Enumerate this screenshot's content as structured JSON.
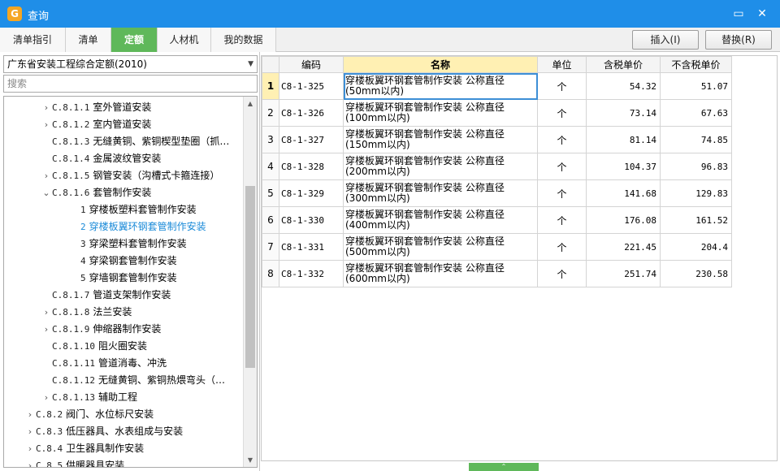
{
  "window": {
    "title": "查询",
    "app_icon": "app-logo-icon",
    "min_label": "▭",
    "close_label": "✕"
  },
  "tabs": [
    {
      "label": "清单指引",
      "active": false
    },
    {
      "label": "清单",
      "active": false
    },
    {
      "label": "定额",
      "active": true
    },
    {
      "label": "人材机",
      "active": false
    },
    {
      "label": "我的数据",
      "active": false
    }
  ],
  "toolbar": {
    "insert_label": "插入(I)",
    "replace_label": "替换(R)"
  },
  "left": {
    "dropdown_value": "广东省安装工程综合定额(2010)",
    "search_placeholder": "搜索",
    "tree": [
      {
        "chev": "›",
        "code": "C.8.1.1",
        "label": "室外管道安装"
      },
      {
        "chev": "›",
        "code": "C.8.1.2",
        "label": "室内管道安装"
      },
      {
        "chev": "",
        "code": "C.8.1.3",
        "label": "无缝黄铜、紫铜楔型垫圈（抓…"
      },
      {
        "chev": "",
        "code": "C.8.1.4",
        "label": "金属波纹管安装"
      },
      {
        "chev": "›",
        "code": "C.8.1.5",
        "label": "钢管安装（沟槽式卡箍连接）"
      },
      {
        "chev": "⌄",
        "code": "C.8.1.6",
        "label": "套管制作安装"
      },
      {
        "chev": "",
        "code": "1",
        "label": "穿楼板塑料套管制作安装"
      },
      {
        "chev": "",
        "code": "2",
        "label": "穿楼板翼环钢套管制作安装",
        "selected": true
      },
      {
        "chev": "",
        "code": "3",
        "label": "穿梁塑料套管制作安装"
      },
      {
        "chev": "",
        "code": "4",
        "label": "穿梁钢套管制作安装"
      },
      {
        "chev": "",
        "code": "5",
        "label": "穿墙钢套管制作安装"
      },
      {
        "chev": "",
        "code": "C.8.1.7",
        "label": "管道支架制作安装"
      },
      {
        "chev": "›",
        "code": "C.8.1.8",
        "label": "法兰安装"
      },
      {
        "chev": "›",
        "code": "C.8.1.9",
        "label": "伸缩器制作安装"
      },
      {
        "chev": "",
        "code": "C.8.1.10",
        "label": "阻火圈安装"
      },
      {
        "chev": "",
        "code": "C.8.1.11",
        "label": "管道消毒、冲洗"
      },
      {
        "chev": "",
        "code": "C.8.1.12",
        "label": "无缝黄铜、紫铜热煨弯头（…"
      },
      {
        "chev": "›",
        "code": "C.8.1.13",
        "label": "辅助工程"
      },
      {
        "chev": "›",
        "code": "C.8.2",
        "label": "阀门、水位标尺安装"
      },
      {
        "chev": "›",
        "code": "C.8.3",
        "label": "低压器具、水表组成与安装"
      },
      {
        "chev": "›",
        "code": "C.8.4",
        "label": "卫生器具制作安装"
      },
      {
        "chev": "›",
        "code": "C.8.5",
        "label": "供暖器具安装"
      }
    ]
  },
  "table": {
    "headers": [
      "编码",
      "名称",
      "单位",
      "含税单价",
      "不含税单价"
    ],
    "rows": [
      {
        "idx": "1",
        "code": "C8-1-325",
        "name": "穿楼板翼环钢套管制作安装 公称直径(50mm以内)",
        "unit": "个",
        "price_tax": "54.32",
        "price_notax": "51.07"
      },
      {
        "idx": "2",
        "code": "C8-1-326",
        "name": "穿楼板翼环钢套管制作安装 公称直径(100mm以内)",
        "unit": "个",
        "price_tax": "73.14",
        "price_notax": "67.63"
      },
      {
        "idx": "3",
        "code": "C8-1-327",
        "name": "穿楼板翼环钢套管制作安装 公称直径(150mm以内)",
        "unit": "个",
        "price_tax": "81.14",
        "price_notax": "74.85"
      },
      {
        "idx": "4",
        "code": "C8-1-328",
        "name": "穿楼板翼环钢套管制作安装 公称直径(200mm以内)",
        "unit": "个",
        "price_tax": "104.37",
        "price_notax": "96.83"
      },
      {
        "idx": "5",
        "code": "C8-1-329",
        "name": "穿楼板翼环钢套管制作安装 公称直径(300mm以内)",
        "unit": "个",
        "price_tax": "141.68",
        "price_notax": "129.83"
      },
      {
        "idx": "6",
        "code": "C8-1-330",
        "name": "穿楼板翼环钢套管制作安装 公称直径(400mm以内)",
        "unit": "个",
        "price_tax": "176.08",
        "price_notax": "161.52"
      },
      {
        "idx": "7",
        "code": "C8-1-331",
        "name": "穿楼板翼环钢套管制作安装 公称直径(500mm以内)",
        "unit": "个",
        "price_tax": "221.45",
        "price_notax": "204.4"
      },
      {
        "idx": "8",
        "code": "C8-1-332",
        "name": "穿楼板翼环钢套管制作安装 公称直径(600mm以内)",
        "unit": "个",
        "price_tax": "251.74",
        "price_notax": "230.58"
      }
    ]
  },
  "colors": {
    "titlebar": "#1f8ee8",
    "active_tab": "#5fb85a",
    "selected_tree": "#1a8ad8",
    "header_highlight": "#fff0b3"
  }
}
